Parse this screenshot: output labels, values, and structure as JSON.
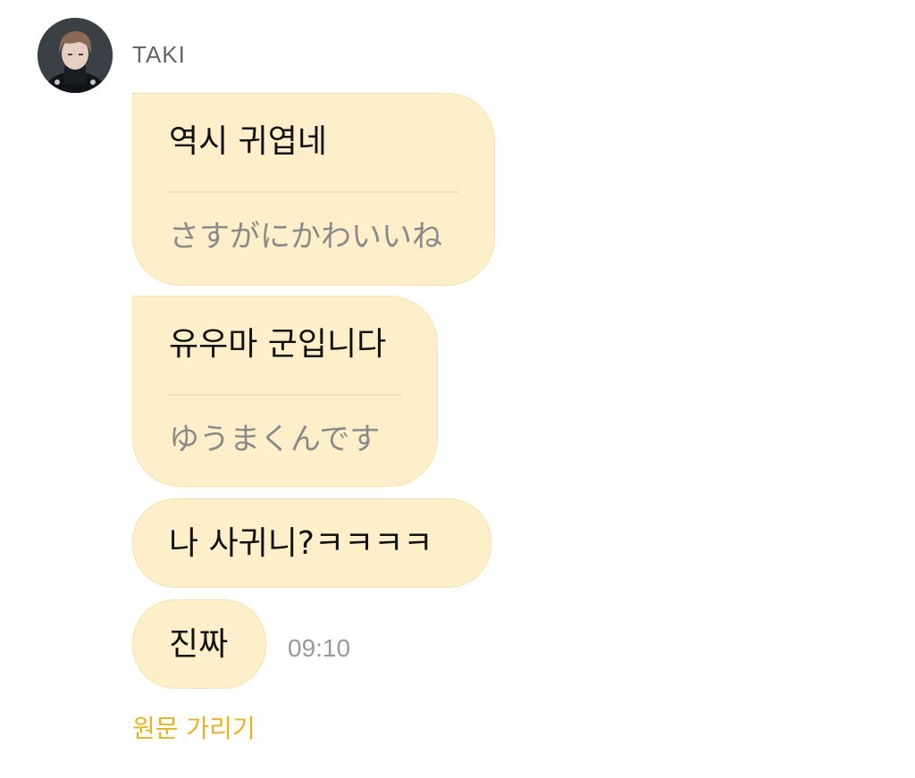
{
  "chat": {
    "sender": {
      "name": "TAKI",
      "avatar_icon": "profile-photo-avatar"
    },
    "messages": [
      {
        "original": "역시 귀엽네",
        "translation": "さすがにかわいいね"
      },
      {
        "original": "유우마 군입니다",
        "translation": "ゆうまくんです"
      },
      {
        "original": "나 사귀니?ㅋㅋㅋㅋ"
      },
      {
        "original": "진짜",
        "time": "09:10"
      }
    ],
    "hide_original_label": "원문 가리기"
  },
  "colors": {
    "bubble": "#fcefc9",
    "translation_text": "#8a8a8a",
    "timestamp": "#999999",
    "link": "#e6b422"
  }
}
